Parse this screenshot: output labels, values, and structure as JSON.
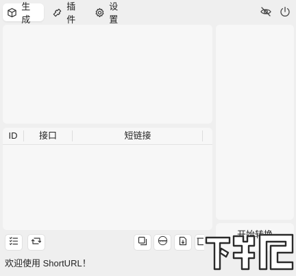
{
  "tabs": [
    {
      "label": "生成",
      "icon": "cube-icon",
      "active": true
    },
    {
      "label": "插件",
      "icon": "puzzle-icon",
      "active": false
    },
    {
      "label": "设置",
      "icon": "gear-icon",
      "active": false
    }
  ],
  "top_right_icons": [
    "eye-off-icon",
    "power-icon"
  ],
  "table": {
    "columns": [
      "ID",
      "接口",
      "短链接"
    ],
    "rows": []
  },
  "toolbar_left": [
    "checklist-icon",
    "swap-icon"
  ],
  "toolbar_right": [
    "copy-icon",
    "www-icon",
    "export-icon",
    "delete-icon"
  ],
  "right_panel_button": "开始转换",
  "status_text": "欢迎使用 ShortURL！",
  "watermark": "下载吧"
}
